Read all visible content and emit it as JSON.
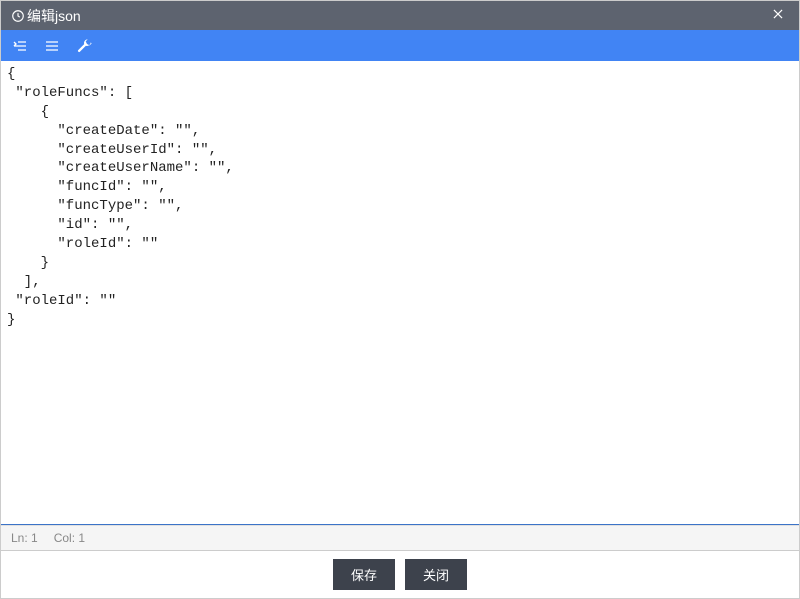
{
  "titlebar": {
    "title": "编辑json",
    "close_label": "×"
  },
  "toolbar": {
    "format_left_icon": "format-left",
    "format_right_icon": "format-right",
    "wrench_icon": "wrench"
  },
  "editor": {
    "content": "{\n \"roleFuncs\": [\n    {\n      \"createDate\": \"\",\n      \"createUserId\": \"\",\n      \"createUserName\": \"\",\n      \"funcId\": \"\",\n      \"funcType\": \"\",\n      \"id\": \"\",\n      \"roleId\": \"\"\n    }\n  ],\n \"roleId\": \"\"\n}"
  },
  "statusbar": {
    "line_label": "Ln: 1",
    "col_label": "Col: 1"
  },
  "footer": {
    "save_label": "保存",
    "close_label": "关闭"
  }
}
